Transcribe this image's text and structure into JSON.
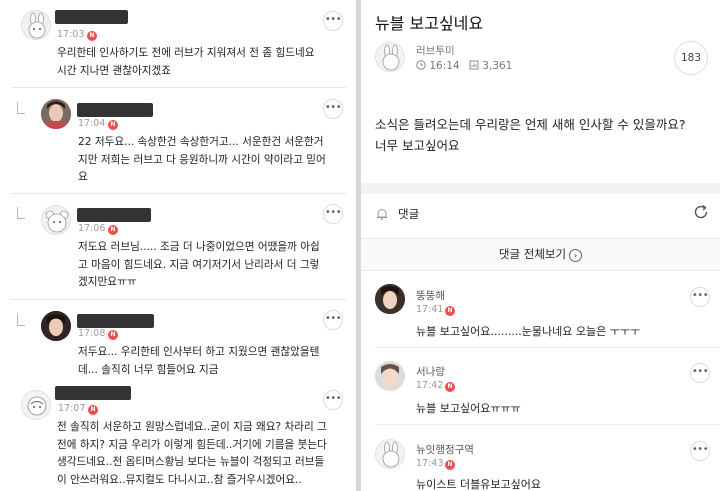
{
  "left_comments": [
    {
      "time": "17:03",
      "lines": [
        "우리한테 인사하기도 전에 러브가 지워져서 전 좀 힘드네요",
        "시간 지나면 괜찮아지겠죠"
      ]
    },
    {
      "time": "17:04",
      "lines": [
        "22 저두요... 속상한건 속상한거고... 서운한건 서운한거",
        "지만 저희는 러브고 다 응원하니까 시간이 약이라고 믿어",
        "요"
      ]
    },
    {
      "time": "17:06",
      "lines": [
        "저도요 러브님..... 조금 더 나중이었으면 어땠을까 아쉽",
        "고 마음이 힘드네요. 지금 여기저기서 난리라서 더 그렇",
        "겠지만요ㅠㅠ"
      ]
    },
    {
      "time": "17:08",
      "lines": [
        "저두요... 우리한테 인사부터 하고 지웠으면 괜찮았을텐",
        "데... 솔직히 너무 힘들어요 지금"
      ]
    },
    {
      "time": "17:07",
      "lines": [
        "전 솔직히 서운하고 원망스럽네요..굳이 지금 왜요? 차라리 그",
        "전에 하지? 지금 우리가 이렇게 힘든데..거기에 기름을 붓는다",
        "생각드네요..전 옵티머스황님 보다는 뉴블이 걱정되고 러브들",
        "이 안쓰러워요..뮤지컬도 다니시고..참 즐거우시겠어요.."
      ]
    }
  ],
  "post": {
    "title": "뉴블 보고싶네요",
    "author": "러브투미",
    "time": "16:14",
    "views": "3,361",
    "comment_count": "183",
    "body_lines": [
      "소식은 들려오는데 우리랑은 언제 새해 인사할 수 있을까요?",
      "너무 보고싶어요"
    ]
  },
  "comments_section": {
    "header": "댓글",
    "view_all": "댓글 전체보기"
  },
  "right_comments": [
    {
      "name": "뚱뚱해",
      "time": "17:41",
      "text": "뉴블 보고싶어요.........눈물나네요 오늘은 ㅜㅜㅜ"
    },
    {
      "name": "서나랑",
      "time": "17:42",
      "text": "뉴블 보고싶어요ㅠㅠㅠ"
    },
    {
      "name": "뉴잇행정구역",
      "time": "17:43",
      "text": "뉴이스트 더블유보고싶어요"
    }
  ],
  "badge_letter": "N",
  "more_glyph": "•••",
  "colors": {
    "badge": "#ef4e4e",
    "gap": "#f2f2f2",
    "divider": "#d9d9d9"
  }
}
